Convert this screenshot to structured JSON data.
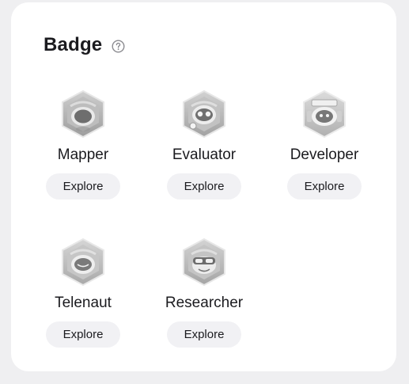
{
  "section": {
    "title": "Badge",
    "help_icon": "question-circle-icon"
  },
  "badges": [
    {
      "name": "Mapper",
      "button": "Explore",
      "icon": "mapper-badge-icon"
    },
    {
      "name": "Evaluator",
      "button": "Explore",
      "icon": "evaluator-badge-icon"
    },
    {
      "name": "Developer",
      "button": "Explore",
      "icon": "developer-badge-icon"
    },
    {
      "name": "Telenaut",
      "button": "Explore",
      "icon": "telenaut-badge-icon"
    },
    {
      "name": "Researcher",
      "button": "Explore",
      "icon": "researcher-badge-icon"
    }
  ],
  "colors": {
    "page_background": "#efeff1",
    "card_background": "#ffffff",
    "button_background": "#f1f1f4",
    "text": "#1b1b1f",
    "badge_gray": "#b9b9b9"
  }
}
